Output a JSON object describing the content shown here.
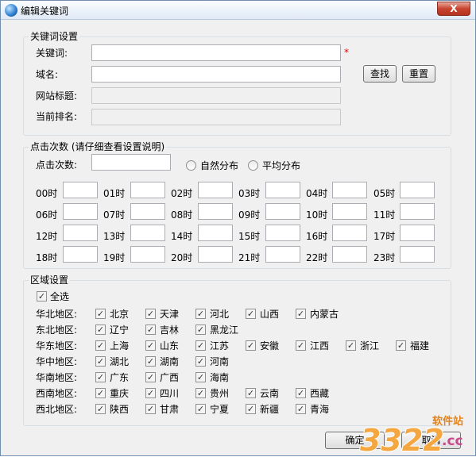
{
  "window": {
    "title": "编辑关键词",
    "close_glyph": "X"
  },
  "keyword_group": {
    "legend": "关键词设置",
    "keyword_label": "关键词:",
    "keyword_value": "",
    "required_mark": "*",
    "domain_label": "域名:",
    "domain_value": "",
    "site_title_label": "网站标题:",
    "site_title_value": "",
    "rank_label": "当前排名:",
    "rank_value": "",
    "find_button": "查找",
    "reset_button": "重置"
  },
  "clicks_group": {
    "legend": "点击次数 (请仔细查看设置说明)",
    "clicks_label": "点击次数:",
    "clicks_value": "",
    "radio_natural": "自然分布",
    "radio_average": "平均分布",
    "hours": [
      "00时",
      "01时",
      "02时",
      "03时",
      "04时",
      "05时",
      "06时",
      "07时",
      "08时",
      "09时",
      "10时",
      "11时",
      "12时",
      "13时",
      "14时",
      "15时",
      "16时",
      "17时",
      "18时",
      "19时",
      "20时",
      "21时",
      "22时",
      "23时"
    ]
  },
  "region_group": {
    "legend": "区域设置",
    "select_all": "全选",
    "regions": [
      {
        "label": "华北地区:",
        "items": [
          "北京",
          "天津",
          "河北",
          "山西",
          "内蒙古"
        ]
      },
      {
        "label": "东北地区:",
        "items": [
          "辽宁",
          "吉林",
          "黑龙江"
        ]
      },
      {
        "label": "华东地区:",
        "items": [
          "上海",
          "山东",
          "江苏",
          "安徽",
          "江西",
          "浙江",
          "福建"
        ]
      },
      {
        "label": "华中地区:",
        "items": [
          "湖北",
          "湖南",
          "河南"
        ]
      },
      {
        "label": "华南地区:",
        "items": [
          "广东",
          "广西",
          "海南"
        ]
      },
      {
        "label": "西南地区:",
        "items": [
          "重庆",
          "四川",
          "贵州",
          "云南",
          "西藏"
        ]
      },
      {
        "label": "西北地区:",
        "items": [
          "陕西",
          "甘肃",
          "宁夏",
          "新疆",
          "青海"
        ]
      }
    ],
    "check_glyph": "✓"
  },
  "footer": {
    "ok_button": "确定",
    "cancel_button": "取消"
  },
  "watermark": {
    "number": "3322",
    "site": "软件站",
    "domain": ".cc"
  }
}
